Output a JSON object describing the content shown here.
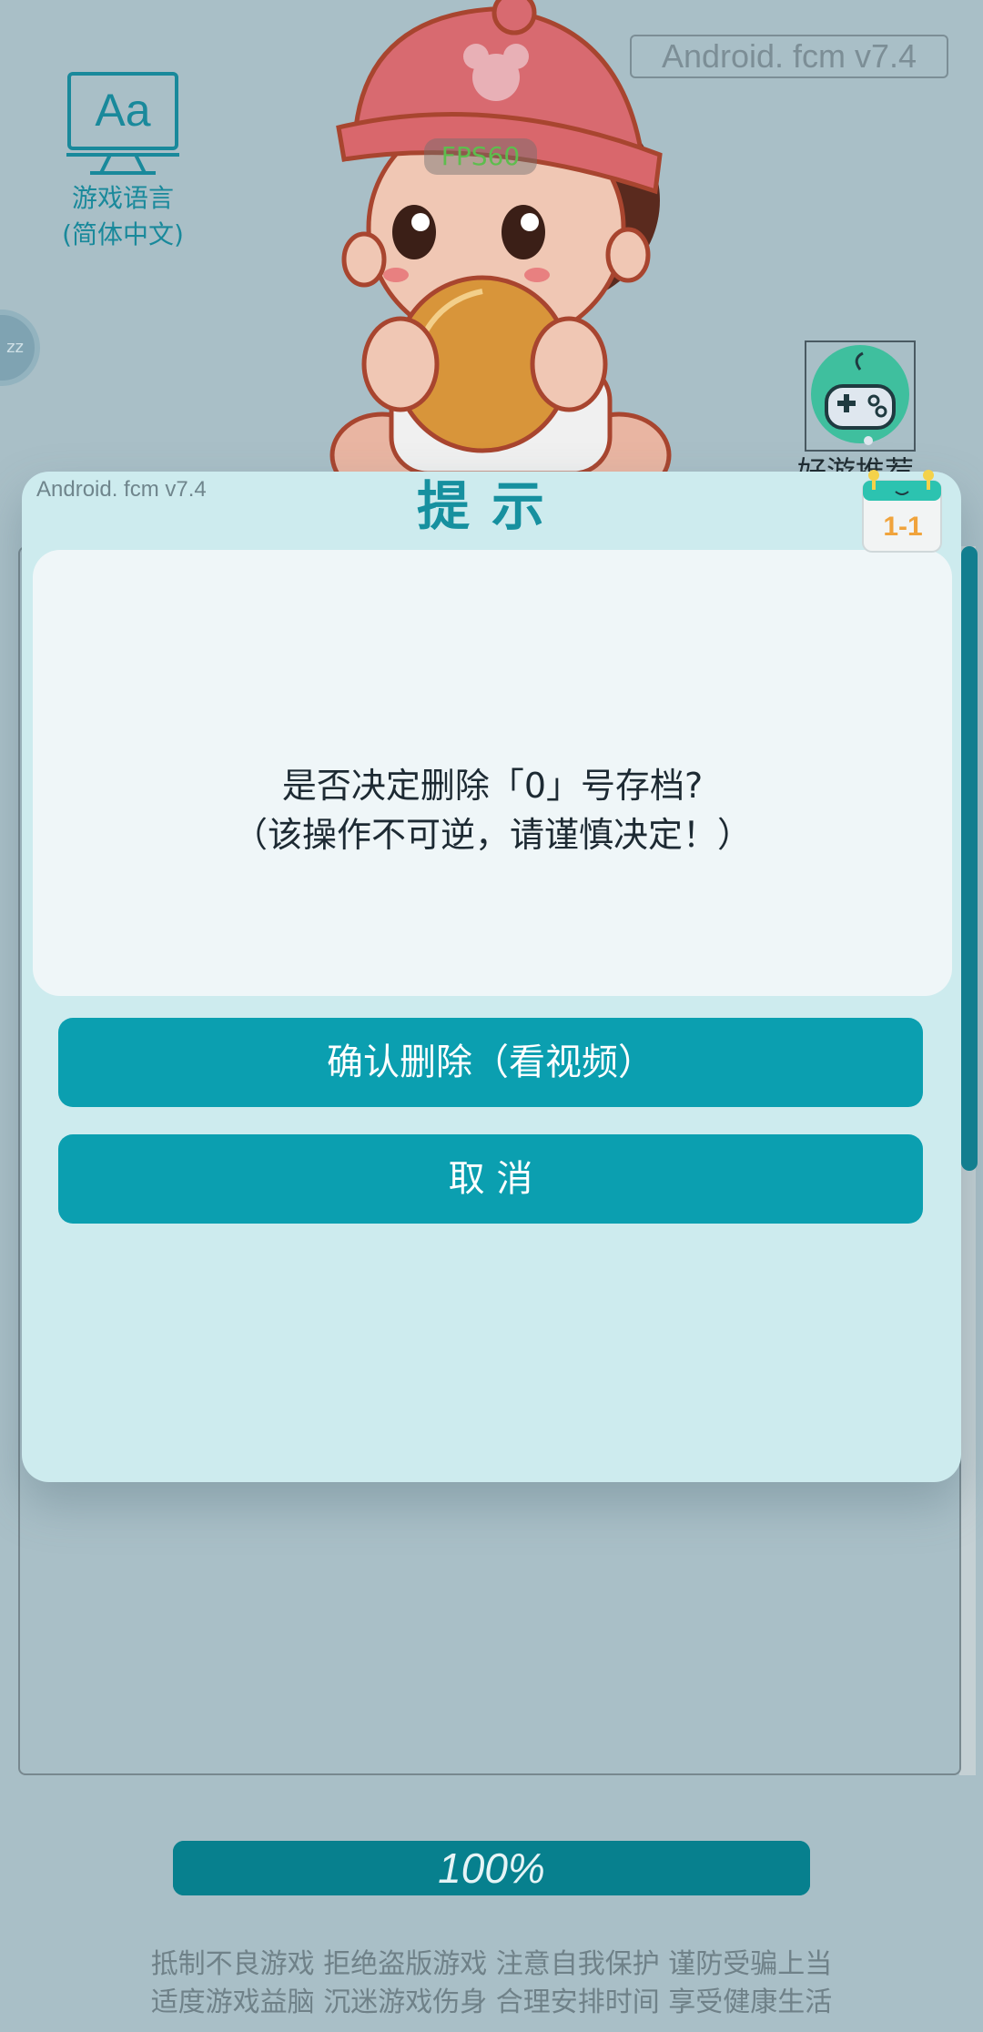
{
  "header": {
    "version_label": "Android. fcm v7.4",
    "fps_label": "FPS60"
  },
  "language": {
    "line1": "游戏语言",
    "line2": "(简体中文)",
    "icon_text": "Aa"
  },
  "sleep_button": {
    "label": "zz"
  },
  "game_recommend": {
    "label": "好游推荐"
  },
  "dialog": {
    "version_label": "Android. fcm v7.4",
    "title": "提示",
    "message_line1": "是否决定删除「0」号存档?",
    "message_line2": "（该操作不可逆，请谨慎决定！）",
    "confirm_label": "确认删除（看视频）",
    "cancel_label": "取 消",
    "level_badge": "1-1"
  },
  "progress": {
    "value": 100,
    "label": "100%"
  },
  "footer": {
    "line1": "抵制不良游戏 拒绝盗版游戏 注意自我保护 谨防受骗上当",
    "line2": "适度游戏益脑 沉迷游戏伤身 合理安排时间 享受健康生活"
  },
  "colors": {
    "background": "#a9bfc7",
    "accent": "#0b9fb0",
    "dialog_bg": "#cdebee",
    "title": "#16909f"
  }
}
